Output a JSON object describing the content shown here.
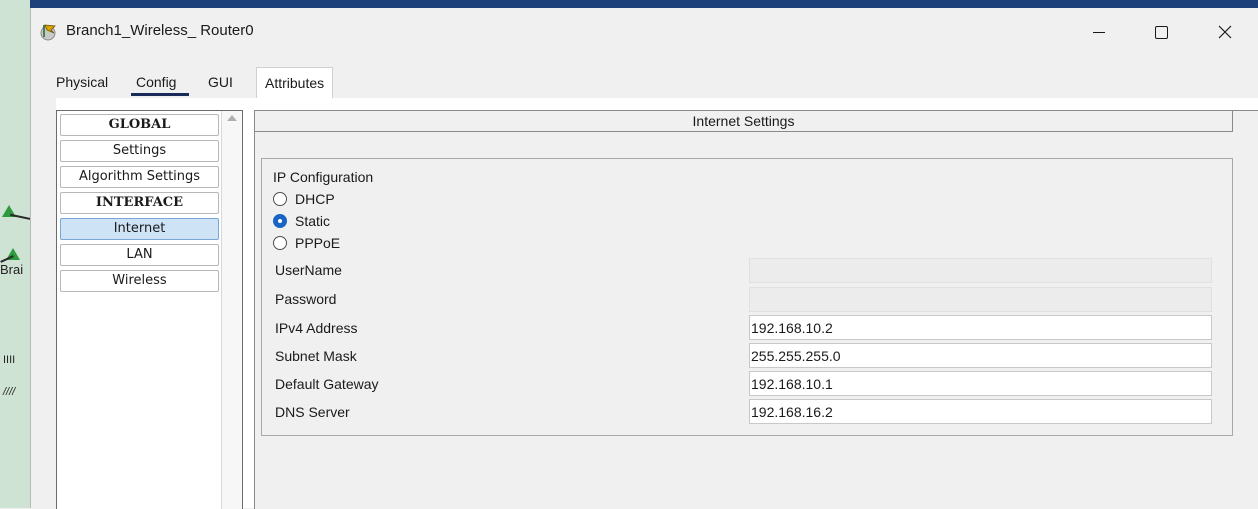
{
  "window": {
    "title": "Branch1_Wireless_ Router0",
    "icon": "router-icon"
  },
  "background": {
    "fragment_text": "Brai",
    "fragment_marks": [
      "IIII",
      "////"
    ]
  },
  "tabs": [
    {
      "label": "Physical",
      "active": false
    },
    {
      "label": "Config",
      "active": true
    },
    {
      "label": "GUI",
      "active": false
    },
    {
      "label": "Attributes",
      "active": false
    }
  ],
  "nav": {
    "items": [
      {
        "label": "GLOBAL",
        "header": true
      },
      {
        "label": "Settings"
      },
      {
        "label": "Algorithm Settings"
      },
      {
        "label": "INTERFACE",
        "header": true
      },
      {
        "label": "Internet",
        "selected": true
      },
      {
        "label": "LAN"
      },
      {
        "label": "Wireless"
      }
    ]
  },
  "settings": {
    "header": "Internet Settings",
    "ip_config_label": "IP Configuration",
    "options": [
      {
        "label": "DHCP",
        "checked": false
      },
      {
        "label": "Static",
        "checked": true
      },
      {
        "label": "PPPoE",
        "checked": false
      }
    ],
    "fields": [
      {
        "label": "UserName",
        "value": "",
        "enabled": false
      },
      {
        "label": "Password",
        "value": "",
        "enabled": false
      },
      {
        "label": "IPv4 Address",
        "value": "192.168.10.2",
        "enabled": true
      },
      {
        "label": "Subnet Mask",
        "value": "255.255.255.0",
        "enabled": true
      },
      {
        "label": "Default Gateway",
        "value": "192.168.10.1",
        "enabled": true
      },
      {
        "label": "DNS Server",
        "value": "192.168.16.2",
        "enabled": true
      }
    ]
  },
  "colors": {
    "accent": "#1964c4",
    "selection": "#cfe3f7",
    "tab_underline": "#1a2a5a"
  }
}
